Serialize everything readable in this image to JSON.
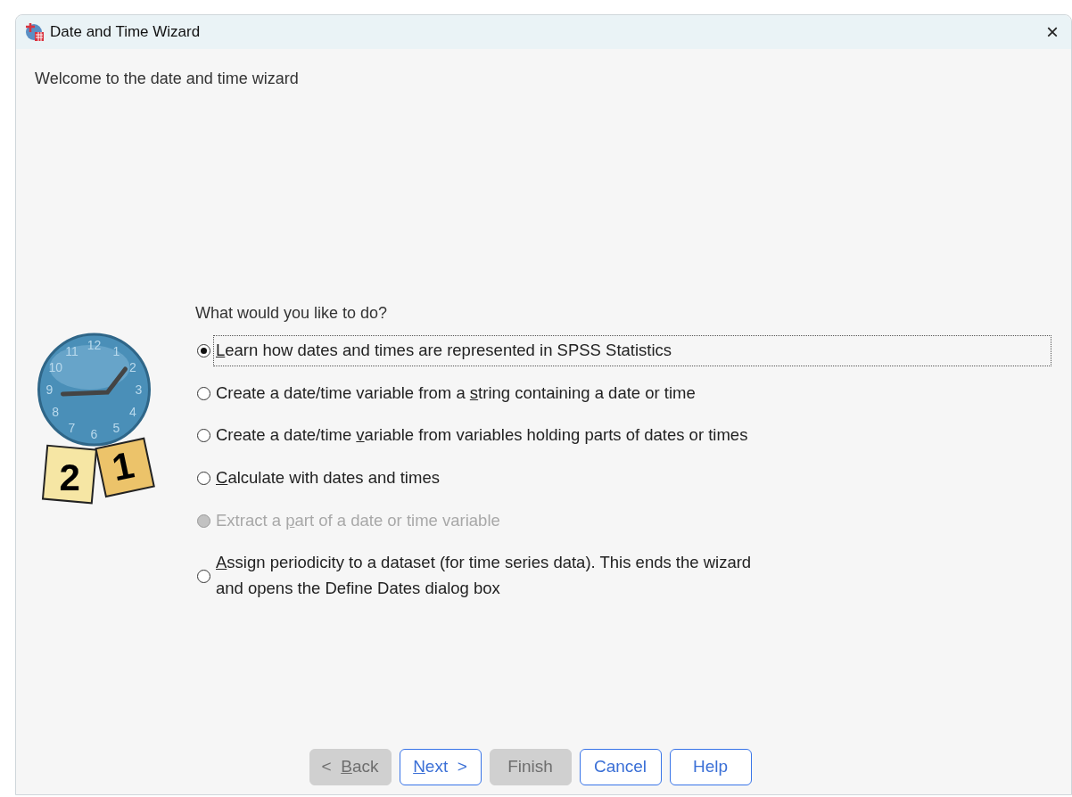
{
  "window": {
    "title": "Date and Time Wizard",
    "close": "×"
  },
  "heading": "Welcome to the date and time wizard",
  "clock_numbers": [
    "12",
    "1",
    "2",
    "3",
    "4",
    "5",
    "6",
    "7",
    "8",
    "9",
    "10",
    "11"
  ],
  "calendar_pages": [
    "2",
    "1"
  ],
  "question": "What would you like to do?",
  "options": [
    {
      "key": "L",
      "rest": "earn how dates and times are represented in SPSS Statistics",
      "selected": true,
      "disabled": false,
      "focused": true
    },
    {
      "prefix": "Create a date/time variable from a ",
      "key": "s",
      "rest": "tring containing a date or time",
      "selected": false,
      "disabled": false,
      "focused": false
    },
    {
      "prefix": "Create a date/time ",
      "key": "v",
      "rest": "ariable from variables holding parts of dates or times",
      "selected": false,
      "disabled": false,
      "focused": false
    },
    {
      "key": "C",
      "rest": "alculate with dates and times",
      "selected": false,
      "disabled": false,
      "focused": false
    },
    {
      "prefix": "Extract a ",
      "key": "p",
      "rest": "art of a date or time variable",
      "selected": false,
      "disabled": true,
      "focused": false
    },
    {
      "key": "A",
      "rest": "ssign periodicity to a dataset (for time series data). This ends the wizard\nand opens the Define Dates dialog box",
      "selected": false,
      "disabled": false,
      "focused": false
    }
  ],
  "buttons": [
    {
      "prefix": "<  ",
      "key": "B",
      "rest": "ack",
      "disabled": true
    },
    {
      "key": "N",
      "rest": "ext  >",
      "disabled": false
    },
    {
      "rest": "Finish",
      "disabled": true
    },
    {
      "rest": "Cancel",
      "disabled": false
    },
    {
      "rest": "Help",
      "disabled": false
    }
  ]
}
